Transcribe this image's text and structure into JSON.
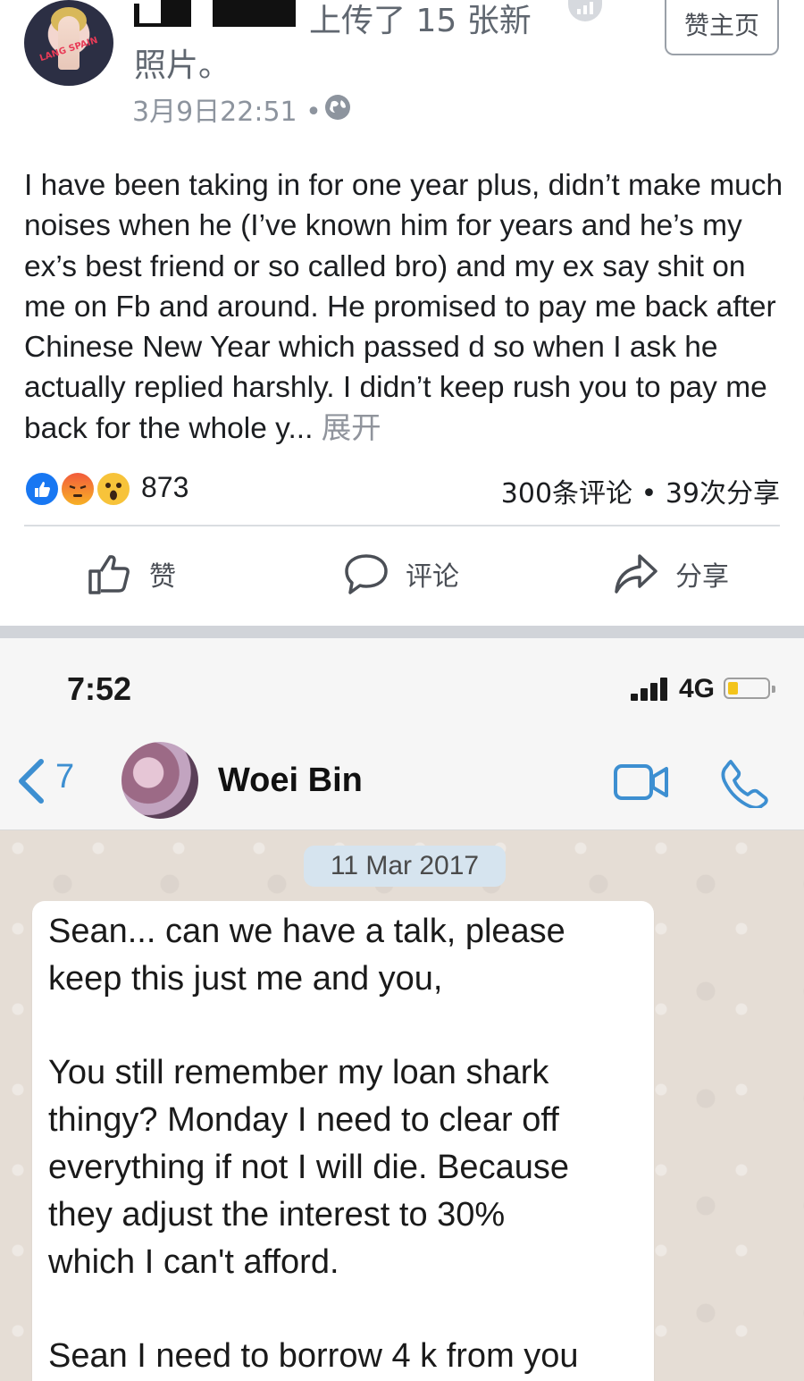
{
  "post": {
    "header_suffix": "上传了 15 张新",
    "header_line2": "照片。",
    "page_button": "赞主页",
    "timestamp": "3月9日22:51 •",
    "body": "I have been taking in for one year plus, didn’t make much noises when he (I’ve known him for years and he’s my ex’s best friend or so called bro) and my ex say shit on me on Fb and around. He promised to pay me back after Chinese New Year which passed d so when I ask he actually replied harshly. I didn’t keep rush you to pay me back for the whole y...",
    "see_more": "展开",
    "reaction_count": "873",
    "comments_shares": "300条评论 • 39次分享",
    "actions": {
      "like": "赞",
      "comment": "评论",
      "share": "分享"
    },
    "avatar_brand": "LANG SPAIN"
  },
  "chat": {
    "status_time": "7:52",
    "network": "4G",
    "battery_level": 0.25,
    "back_count": "7",
    "contact_name": "Woei Bin",
    "date_pill": "11 Mar 2017",
    "message_1": "Sean... can we have a talk, please\nkeep this just me and you,",
    "message_2": "You still remember my loan shark\nthingy? Monday I need to clear off\neverything if not I will die. Because\nthey adjust the interest to 30%\nwhich I can't  afford.",
    "message_3": "Sean I need to borrow 4 k from you"
  },
  "colors": {
    "facebook_blue": "#1877f2",
    "whatsapp_blue": "#3d8fd1",
    "chat_background": "#e5ddd5",
    "battery_yellow": "#f3c41b"
  },
  "icons": [
    "globe-icon",
    "stats-icon",
    "like-icon",
    "comment-icon",
    "share-icon",
    "back-chevron-icon",
    "video-call-icon",
    "phone-icon",
    "signal-icon",
    "battery-icon"
  ]
}
